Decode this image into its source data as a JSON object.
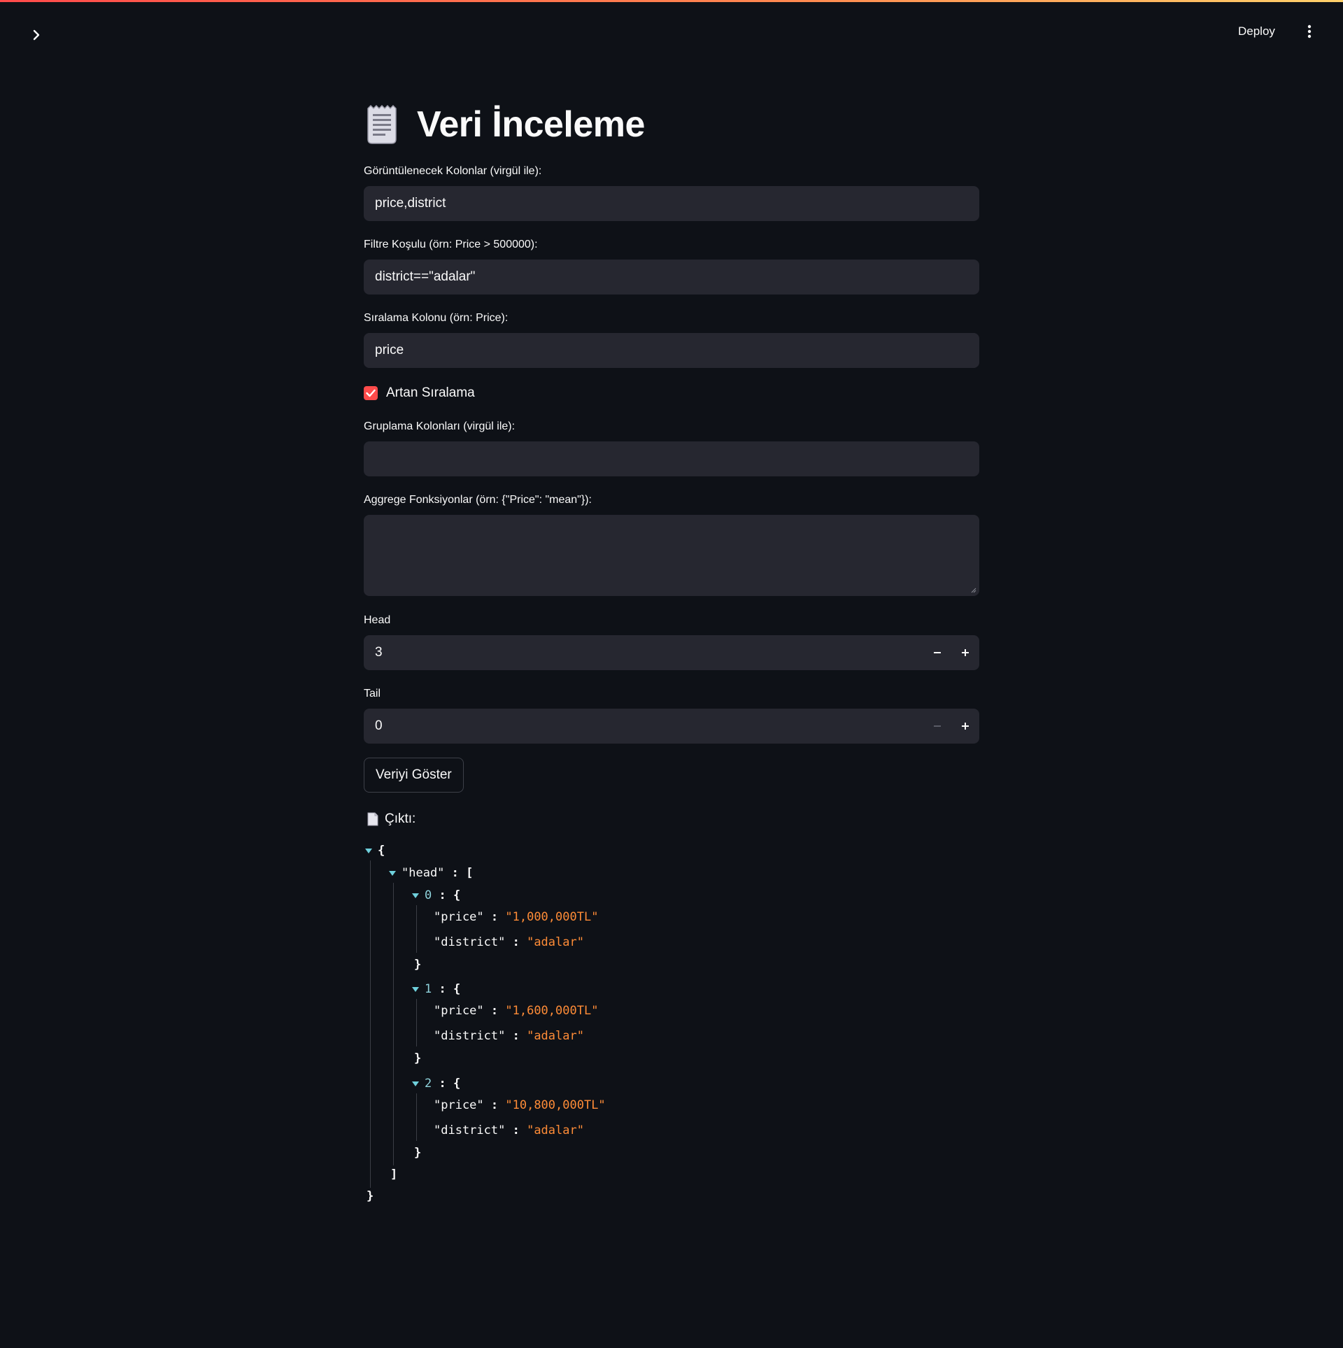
{
  "header": {
    "deploy_label": "Deploy"
  },
  "page": {
    "title": "Veri İnceleme"
  },
  "form": {
    "columns_label": "Görüntülenecek Kolonlar (virgül ile):",
    "columns_value": "price,district",
    "filter_label": "Filtre Koşulu (örn: Price > 500000):",
    "filter_value": "district==\"adalar\"",
    "sort_label": "Sıralama Kolonu (örn: Price):",
    "sort_value": "price",
    "ascending_label": "Artan Sıralama",
    "ascending_checked": true,
    "group_label": "Gruplama Kolonları (virgül ile):",
    "group_value": "",
    "agg_label": "Aggrege Fonksiyonlar (örn: {\"Price\": \"mean\"}):",
    "agg_value": "",
    "head_label": "Head",
    "head_value": "3",
    "tail_label": "Tail",
    "tail_value": "0",
    "submit_label": "Veriyi Göster"
  },
  "output": {
    "label": "Çıktı:",
    "json": {
      "open_brace": "{",
      "close_brace": "}",
      "head_key": "\"head\"",
      "colon": " : ",
      "open_bracket": "[",
      "close_bracket": "]",
      "price_key": "\"price\"",
      "district_key": "\"district\"",
      "rows": [
        {
          "index": "0",
          "price": "\"1,000,000TL\"",
          "district": "\"adalar\""
        },
        {
          "index": "1",
          "price": "\"1,600,000TL\"",
          "district": "\"adalar\""
        },
        {
          "index": "2",
          "price": "\"10,800,000TL\"",
          "district": "\"adalar\""
        }
      ]
    }
  },
  "colors": {
    "accent": "#ff4b4b",
    "background": "#0e1117",
    "input_bg": "#262730",
    "json_string": "#ff8c37",
    "json_caret": "#6fd0dc"
  },
  "icons": {
    "title_icon": "receipt-icon",
    "output_icon": "document-icon",
    "sidebar": "chevron-right-icon",
    "menu": "vertical-dots-icon"
  }
}
